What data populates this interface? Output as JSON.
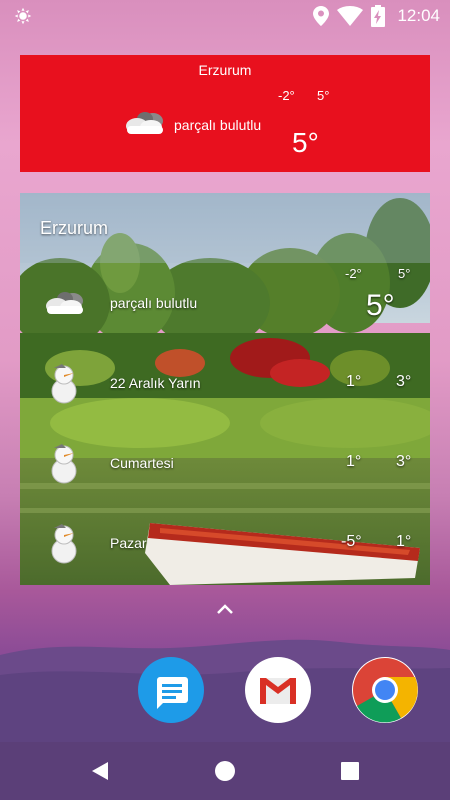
{
  "status_bar": {
    "time": "12:04",
    "icons": [
      "brightness-icon",
      "location-icon",
      "wifi-icon",
      "battery-charging-icon"
    ]
  },
  "red_widget": {
    "city": "Erzurum",
    "low": "-2°",
    "high": "5°",
    "condition": "parçalı bulutlu",
    "current_temp": "5°",
    "icon": "partly-cloudy-icon",
    "background_color": "#e8101e"
  },
  "photo_widget": {
    "city": "Erzurum",
    "today": {
      "low": "-2°",
      "high": "5°",
      "condition": "parçalı bulutlu",
      "current_temp": "5°",
      "icon": "partly-cloudy-icon"
    },
    "forecast": [
      {
        "label": "22 Aralık Yarın",
        "low": "1°",
        "high": "3°",
        "icon": "snowman-icon"
      },
      {
        "label": "Cumartesi",
        "low": "1°",
        "high": "3°",
        "icon": "snowman-icon"
      },
      {
        "label": "Pazar",
        "low": "-5°",
        "high": "1°",
        "icon": "snowman-icon"
      }
    ]
  },
  "dock": {
    "apps": [
      "messages-app-icon",
      "gmail-app-icon",
      "chrome-app-icon"
    ]
  },
  "nav": {
    "buttons": [
      "back-button",
      "home-button",
      "recents-button"
    ]
  }
}
